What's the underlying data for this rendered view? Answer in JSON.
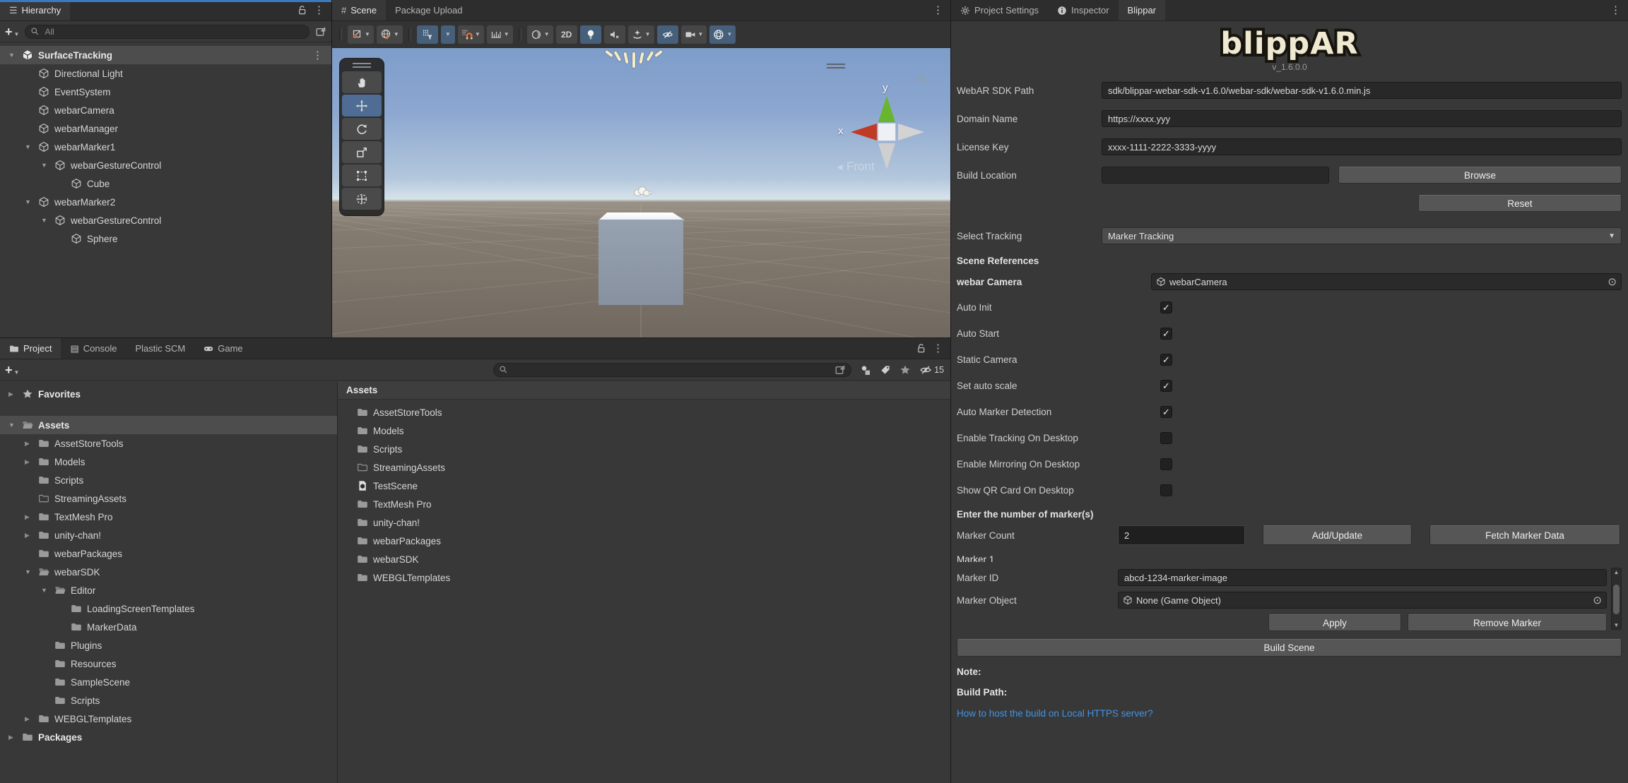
{
  "colors": {
    "focus_line_blue": "#3a79bb",
    "toggle_active_blue": "#46607c",
    "selection_grey": "#4d4d4d",
    "link_blue": "#4094e4",
    "logo_cream": "#f0e9d2"
  },
  "hierarchy": {
    "tab_label": "Hierarchy",
    "search_placeholder": "All",
    "icons": [
      "hierarchy-icon",
      "unlock-icon",
      "kebab-menu-icon",
      "add-icon",
      "dropdown-caret-icon",
      "search-icon",
      "pick-window-icon"
    ],
    "items": [
      {
        "label": "SurfaceTracking",
        "level": 0,
        "arrow": "open",
        "icon": "scene",
        "cls": "sel bold"
      },
      {
        "label": "Directional Light",
        "level": 1,
        "icon": "cube"
      },
      {
        "label": "EventSystem",
        "level": 1,
        "icon": "cube"
      },
      {
        "label": "webarCamera",
        "level": 1,
        "icon": "cube"
      },
      {
        "label": "webarManager",
        "level": 1,
        "icon": "cube"
      },
      {
        "label": "webarMarker1",
        "level": 1,
        "arrow": "open",
        "icon": "cube"
      },
      {
        "label": "webarGestureControl",
        "level": 2,
        "arrow": "open",
        "icon": "cube"
      },
      {
        "label": "Cube",
        "level": 3,
        "icon": "cube"
      },
      {
        "label": "webarMarker2",
        "level": 1,
        "arrow": "open",
        "icon": "cube"
      },
      {
        "label": "webarGestureControl",
        "level": 2,
        "arrow": "open",
        "icon": "cube"
      },
      {
        "label": "Sphere",
        "level": 3,
        "icon": "cube"
      }
    ]
  },
  "scene": {
    "tabs": [
      {
        "label": "Scene"
      },
      {
        "label": "Package Upload"
      }
    ],
    "toolbar": {
      "mode_2d_label": "2D",
      "icons": [
        "pivot-tool-icon",
        "globe-handle-icon",
        "grid-y-icon",
        "snap-magnet-icon",
        "snap-increment-icon",
        "shading-mode-icon",
        "2d-toggle",
        "lighting-bulb-icon",
        "audio-mute-icon",
        "effects-icon",
        "hidden-objects-eye-icon",
        "camera-icon",
        "gizmos-globe-icon"
      ]
    },
    "tools_overlay": [
      "hand-tool",
      "move-tool",
      "rotate-tool",
      "scale-tool",
      "rect-tool",
      "transform-tool"
    ],
    "active_tool": "move-tool",
    "gizmo": {
      "y_label": "y",
      "x_label": "x",
      "front_label": "Front",
      "front_arrow": "◄"
    }
  },
  "project": {
    "tabs": [
      {
        "label": "Project"
      },
      {
        "label": "Console"
      },
      {
        "label": "Plastic SCM"
      },
      {
        "label": "Game"
      }
    ],
    "hidden_count": "15",
    "icons": [
      "folder-icon",
      "console-icon",
      "game-icon",
      "add-icon",
      "search-icon",
      "pick-window-icon",
      "filter-type-icon",
      "label-tag-icon",
      "favorite-star-icon",
      "hidden-count-eye-icon",
      "unlock-icon",
      "kebab-menu-icon"
    ],
    "tree": [
      {
        "label": "Favorites",
        "level": 0,
        "arrow": "closed",
        "icon": "star",
        "cls": "bold"
      },
      {
        "label": "Assets",
        "level": 0,
        "arrow": "open",
        "icon": "folder-open",
        "cls": "sel bold gap"
      },
      {
        "label": "AssetStoreTools",
        "level": 1,
        "arrow": "closed",
        "icon": "folder"
      },
      {
        "label": "Models",
        "level": 1,
        "arrow": "closed",
        "icon": "folder"
      },
      {
        "label": "Scripts",
        "level": 1,
        "icon": "folder"
      },
      {
        "label": "StreamingAssets",
        "level": 1,
        "icon": "folder-outline"
      },
      {
        "label": "TextMesh Pro",
        "level": 1,
        "arrow": "closed",
        "icon": "folder"
      },
      {
        "label": "unity-chan!",
        "level": 1,
        "arrow": "closed",
        "icon": "folder"
      },
      {
        "label": "webarPackages",
        "level": 1,
        "icon": "folder"
      },
      {
        "label": "webarSDK",
        "level": 1,
        "arrow": "open",
        "icon": "folder-open"
      },
      {
        "label": "Editor",
        "level": 2,
        "arrow": "open",
        "icon": "folder-open"
      },
      {
        "label": "LoadingScreenTemplates",
        "level": 3,
        "icon": "folder"
      },
      {
        "label": "MarkerData",
        "level": 3,
        "icon": "folder"
      },
      {
        "label": "Plugins",
        "level": 2,
        "icon": "folder"
      },
      {
        "label": "Resources",
        "level": 2,
        "icon": "folder"
      },
      {
        "label": "SampleScene",
        "level": 2,
        "icon": "folder"
      },
      {
        "label": "Scripts",
        "level": 2,
        "icon": "folder"
      },
      {
        "label": "WEBGLTemplates",
        "level": 1,
        "arrow": "closed",
        "icon": "folder"
      },
      {
        "label": "Packages",
        "level": 0,
        "arrow": "closed",
        "icon": "folder",
        "cls": "bold"
      }
    ],
    "assets_header": "Assets",
    "assets": [
      {
        "label": "AssetStoreTools",
        "icon": "folder"
      },
      {
        "label": "Models",
        "icon": "folder"
      },
      {
        "label": "Scripts",
        "icon": "folder"
      },
      {
        "label": "StreamingAssets",
        "icon": "folder-outline"
      },
      {
        "label": "TestScene",
        "icon": "scenefile"
      },
      {
        "label": "TextMesh Pro",
        "icon": "folder"
      },
      {
        "label": "unity-chan!",
        "icon": "folder"
      },
      {
        "label": "webarPackages",
        "icon": "folder"
      },
      {
        "label": "webarSDK",
        "icon": "folder"
      },
      {
        "label": "WEBGLTemplates",
        "icon": "folder"
      }
    ]
  },
  "blippar": {
    "tabs": [
      {
        "label": "Project Settings"
      },
      {
        "label": "Inspector"
      },
      {
        "label": "Blippar"
      }
    ],
    "icons": [
      "gear-icon",
      "info-icon",
      "kebab-menu-icon",
      "cube-icon",
      "object-picker-icon",
      "scrollbar-up-icon",
      "scrollbar-down-icon"
    ],
    "logo_text": "blippAR",
    "version": "v_1.6.0.0",
    "form": {
      "sdk_path_label": "WebAR SDK Path",
      "sdk_path_value": "sdk/blippar-webar-sdk-v1.6.0/webar-sdk/webar-sdk-v1.6.0.min.js",
      "domain_label": "Domain Name",
      "domain_value": "https://xxxx.yyy",
      "license_label": "License Key",
      "license_value": "xxxx-1111-2222-3333-yyyy",
      "build_location_label": "Build Location",
      "build_location_value": "",
      "browse_label": "Browse",
      "reset_label": "Reset",
      "select_tracking_label": "Select Tracking",
      "select_tracking_value": "Marker Tracking",
      "scene_references_header": "Scene References",
      "webar_camera_label": "webar Camera",
      "webar_camera_value": "webarCamera",
      "checkboxes": [
        {
          "label": "Auto Init",
          "cls": "on"
        },
        {
          "label": "Auto Start",
          "cls": "on"
        },
        {
          "label": "Static Camera",
          "cls": "on"
        },
        {
          "label": "Set auto scale",
          "cls": "on"
        },
        {
          "label": "Auto Marker Detection",
          "cls": "on"
        },
        {
          "label": "Enable Tracking On Desktop"
        },
        {
          "label": "Enable Mirroring On Desktop"
        },
        {
          "label": "Show QR Card On Desktop"
        }
      ],
      "marker_section_header": "Enter the number of marker(s)",
      "marker_count_label": "Marker Count",
      "marker_count_value": "2",
      "add_update_label": "Add/Update",
      "fetch_label": "Fetch Marker Data",
      "marker1_header": "Marker 1",
      "marker_id_label": "Marker ID",
      "marker_id_value": "abcd-1234-marker-image",
      "marker_object_label": "Marker Object",
      "marker_object_value": "None (Game Object)",
      "apply_label": "Apply",
      "remove_label": "Remove Marker",
      "build_scene_label": "Build Scene",
      "note_label": "Note:",
      "build_path_label": "Build Path:",
      "link_text": "How to host the build on Local HTTPS server?"
    }
  }
}
